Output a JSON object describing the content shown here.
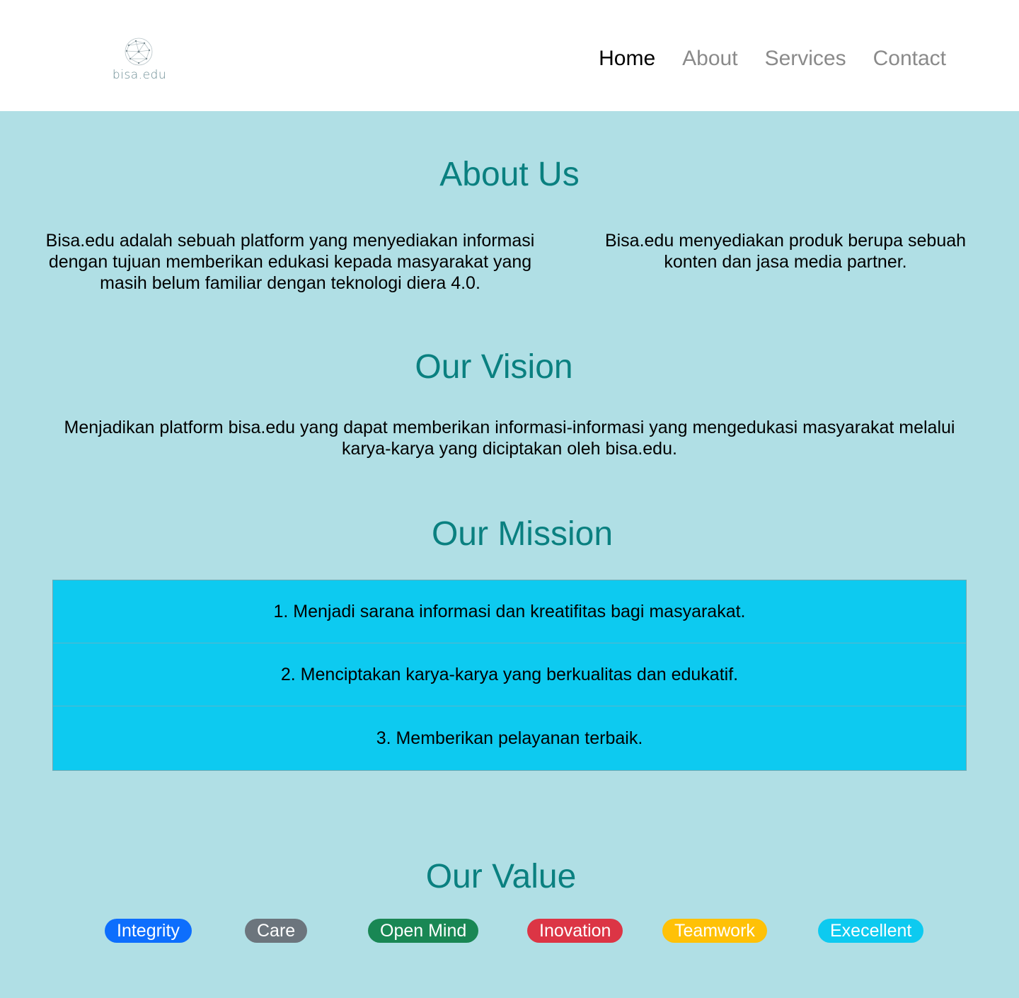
{
  "header": {
    "logo_text": "bisa.edu",
    "nav": [
      {
        "label": "Home",
        "active": true
      },
      {
        "label": "About",
        "active": false
      },
      {
        "label": "Services",
        "active": false
      },
      {
        "label": "Contact",
        "active": false
      }
    ]
  },
  "about": {
    "title": "About Us",
    "left_text": "Bisa.edu adalah sebuah platform yang menyediakan informasi dengan tujuan memberikan edukasi kepada masyarakat yang masih belum familiar dengan teknologi diera 4.0.",
    "right_text": "Bisa.edu menyediakan produk berupa sebuah konten dan jasa media partner."
  },
  "vision": {
    "title": "Our Vision",
    "text": "Menjadikan platform bisa.edu yang dapat memberikan informasi-informasi yang mengedukasi masyarakat melalui karya-karya yang diciptakan oleh bisa.edu."
  },
  "mission": {
    "title": "Our Mission",
    "items": [
      "1. Menjadi sarana informasi dan kreatifitas bagi masyarakat.",
      "2. Menciptakan karya-karya yang berkualitas dan edukatif.",
      "3. Memberikan pelayanan terbaik."
    ]
  },
  "values": {
    "title": "Our Value",
    "badges": [
      {
        "label": "Integrity",
        "color": "#0d6efd"
      },
      {
        "label": "Care",
        "color": "#6c757d"
      },
      {
        "label": "Open Mind",
        "color": "#198754"
      },
      {
        "label": "Inovation",
        "color": "#dc3545"
      },
      {
        "label": "Teamwork",
        "color": "#ffc107"
      },
      {
        "label": "Execellent",
        "color": "#0dcaf0"
      }
    ]
  },
  "colors": {
    "page_background": "#b0dfe5",
    "heading": "#0a8080",
    "mission_background": "#0dcaf0"
  }
}
